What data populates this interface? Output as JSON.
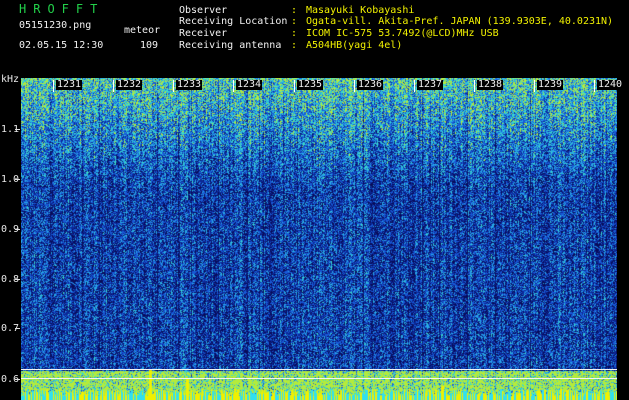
{
  "header": {
    "logo": "HROFFT",
    "filename": "05151230.png",
    "datetime": "02.05.15 12:30",
    "event_label": "meteor",
    "event_count": "109",
    "fields": [
      {
        "label": "Observer",
        "value": "Masayuki Kobayashi"
      },
      {
        "label": "Receiving Location",
        "value": "Ogata-vill. Akita-Pref. JAPAN (139.9303E, 40.0231N)"
      },
      {
        "label": "Receiver",
        "value": "ICOM IC-575 53.7492(@LCD)MHz USB"
      },
      {
        "label": "Receiving antenna",
        "value": "A504HB(yagi 4el)"
      }
    ]
  },
  "axis": {
    "unit": "kHz",
    "freq_ticks": [
      "1.1",
      "1.0",
      "0.9",
      "0.8",
      "0.7",
      "0.6"
    ],
    "time_ticks": [
      "1231",
      "1232",
      "1233",
      "1234",
      "1235",
      "1236",
      "1237",
      "1238",
      "1239",
      "1240"
    ]
  },
  "colors": {
    "background": "#000000",
    "header_text": "#f2f2f2",
    "header_values": "#f2f200",
    "logo": "#22d04a",
    "spectrum_low": "#0a1a8c",
    "spectrum_mid": "#1e6ee6",
    "spectrum_high": "#32e6c8"
  }
}
